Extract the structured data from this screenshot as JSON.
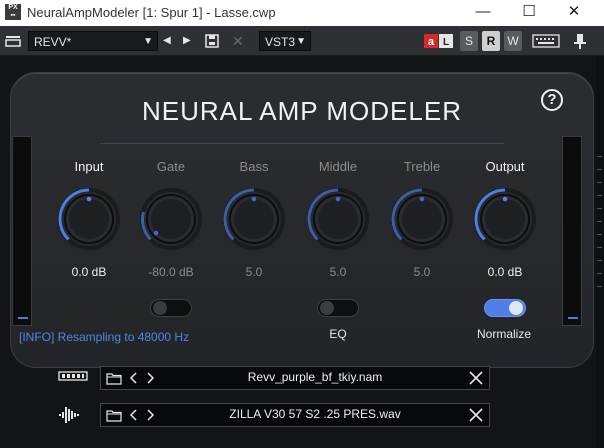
{
  "window": {
    "title": "NeuralAmpModeler [1: Spur 1] - Lasse.cwp",
    "minimize": "—",
    "maximize": "☐",
    "close": "✕"
  },
  "toolbar": {
    "preset": "REVV*",
    "plugin_format": "VST3",
    "btn_s": "S",
    "btn_r": "R",
    "btn_w": "W"
  },
  "plugin": {
    "brand": "NEURAL AMP MODELER",
    "help": "?",
    "knobs": [
      {
        "label": "Input",
        "value": "0.0 dB",
        "active": true
      },
      {
        "label": "Gate",
        "value": "-80.0 dB",
        "active": false
      },
      {
        "label": "Bass",
        "value": "5.0",
        "active": false
      },
      {
        "label": "Middle",
        "value": "5.0",
        "active": false
      },
      {
        "label": "Treble",
        "value": "5.0",
        "active": false
      },
      {
        "label": "Output",
        "value": "0.0 dB",
        "active": true
      }
    ],
    "toggles": {
      "eq_label": "EQ",
      "normalize_label": "Normalize",
      "gate_on": false,
      "eq_on": false,
      "normalize_on": true
    },
    "info": "[INFO] Resampling to 48000 Hz",
    "model_file": "Revv_purple_bf_tkiy.nam",
    "ir_file": "ZILLA V30 57 S2 .25 PRES.wav"
  },
  "colors": {
    "accent": "#4f86e8",
    "panel": "#2a2c30",
    "background": "#131416"
  }
}
